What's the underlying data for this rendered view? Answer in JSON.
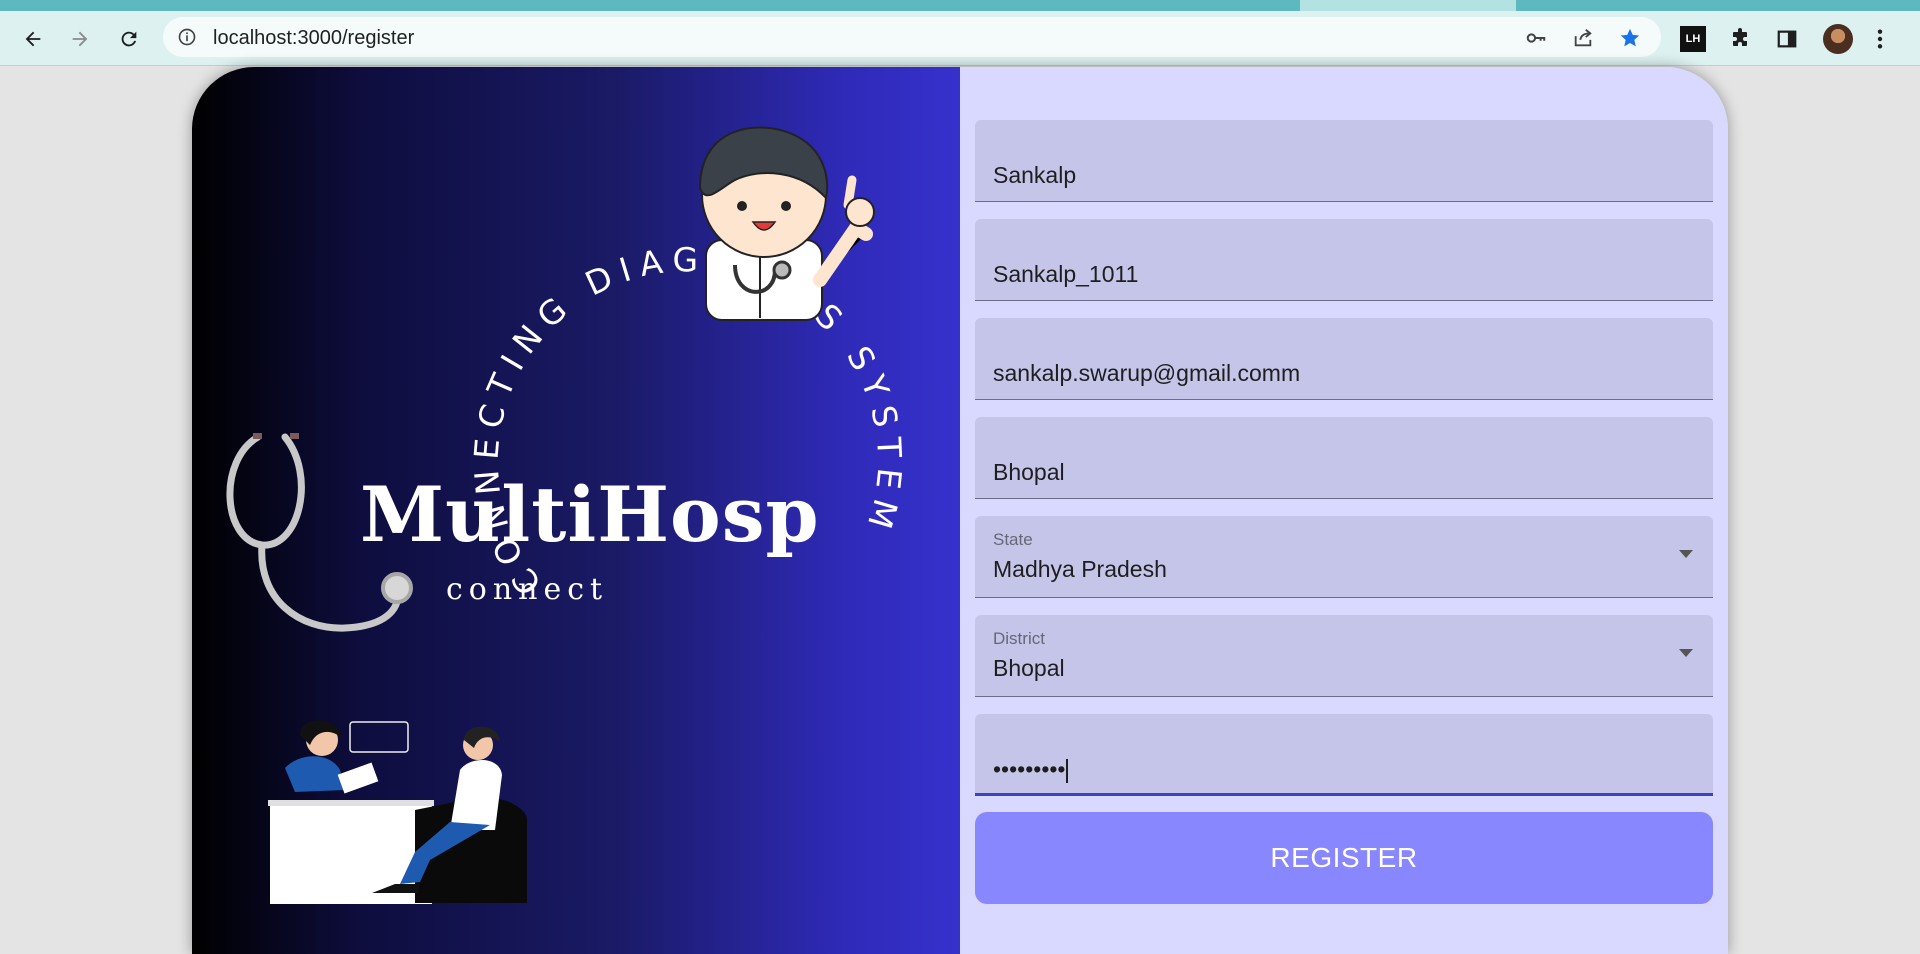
{
  "browser": {
    "url": "localhost:3000/register",
    "extension_badge": "LH",
    "colors": {
      "tab_strip": "#b2e2e2",
      "toolbar": "#ddf1f1",
      "star": "#1a73e8"
    }
  },
  "brand": {
    "title": "MultiHosp",
    "subtitle": "connect",
    "ring_text": "CONNECTING DIAGNOSIS SYSTEM"
  },
  "form": {
    "name": {
      "value": "Sankalp"
    },
    "username": {
      "value": "Sankalp_1011"
    },
    "email": {
      "value": "sankalp.swarup@gmail.comm"
    },
    "city": {
      "value": "Bhopal"
    },
    "state": {
      "label": "State",
      "value": "Madhya Pradesh"
    },
    "district": {
      "label": "District",
      "value": "Bhopal"
    },
    "password": {
      "value": "•••••••••"
    },
    "submit_label": "REGISTER"
  },
  "colors": {
    "page_bg": "#e4e4e4",
    "form_bg": "#d9d8ff",
    "field_bg": "#c5c5ea",
    "button_bg": "#8887fd",
    "focus_underline": "#3f40c4"
  }
}
